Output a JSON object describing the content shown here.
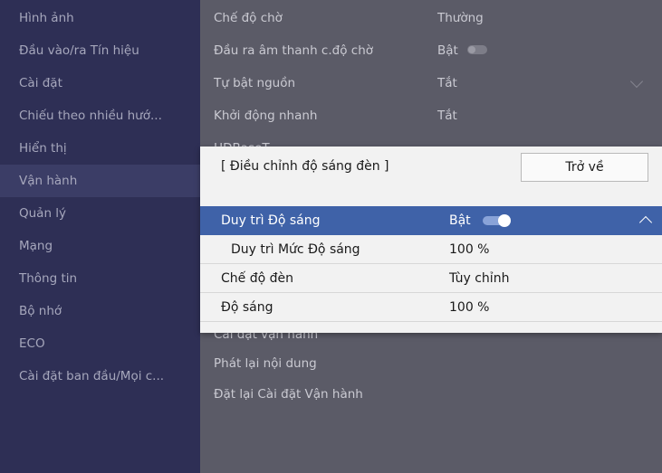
{
  "sidebar": {
    "items": [
      {
        "label": "Hình ảnh"
      },
      {
        "label": "Đầu vào/ra Tín hiệu"
      },
      {
        "label": "Cài đặt"
      },
      {
        "label": "Chiếu theo nhiều hướ..."
      },
      {
        "label": "Hiển thị"
      },
      {
        "label": "Vận hành"
      },
      {
        "label": "Quản lý"
      },
      {
        "label": "Mạng"
      },
      {
        "label": "Thông tin"
      },
      {
        "label": "Bộ nhớ"
      },
      {
        "label": "ECO"
      },
      {
        "label": "Cài đặt ban đầu/Mọi c..."
      }
    ],
    "active_index": 5
  },
  "main": {
    "rows": [
      {
        "label": "Chế độ chờ",
        "value": "Thường"
      },
      {
        "label": "Đầu ra âm thanh c.độ chờ",
        "value": "Bật"
      },
      {
        "label": "Tự bật nguồn",
        "value": "Tắt"
      },
      {
        "label": "Khởi động nhanh",
        "value": "Tắt"
      },
      {
        "label": "HDBaseT",
        "value": ""
      },
      {
        "label": "Cài đặt vận hành",
        "value": ""
      },
      {
        "label": "Phát lại nội dung",
        "value": ""
      },
      {
        "label": "Đặt lại Cài đặt Vận hành",
        "value": ""
      }
    ]
  },
  "dialog": {
    "title": "[ Điều chỉnh độ sáng đèn ]",
    "back_label": "Trở về",
    "rows": [
      {
        "label": "Duy trì Độ sáng",
        "value": "Bật",
        "selected": true
      },
      {
        "label": "Duy trì Mức Độ sáng",
        "value": "100 %"
      },
      {
        "label": "Chế độ đèn",
        "value": "Tùy chỉnh"
      },
      {
        "label": "Độ sáng",
        "value": "100 %"
      }
    ]
  },
  "colors": {
    "sidebar_bg": "#2e2f55",
    "selected_row": "#3f62a8",
    "dialog_bg": "#f2f2f2"
  }
}
